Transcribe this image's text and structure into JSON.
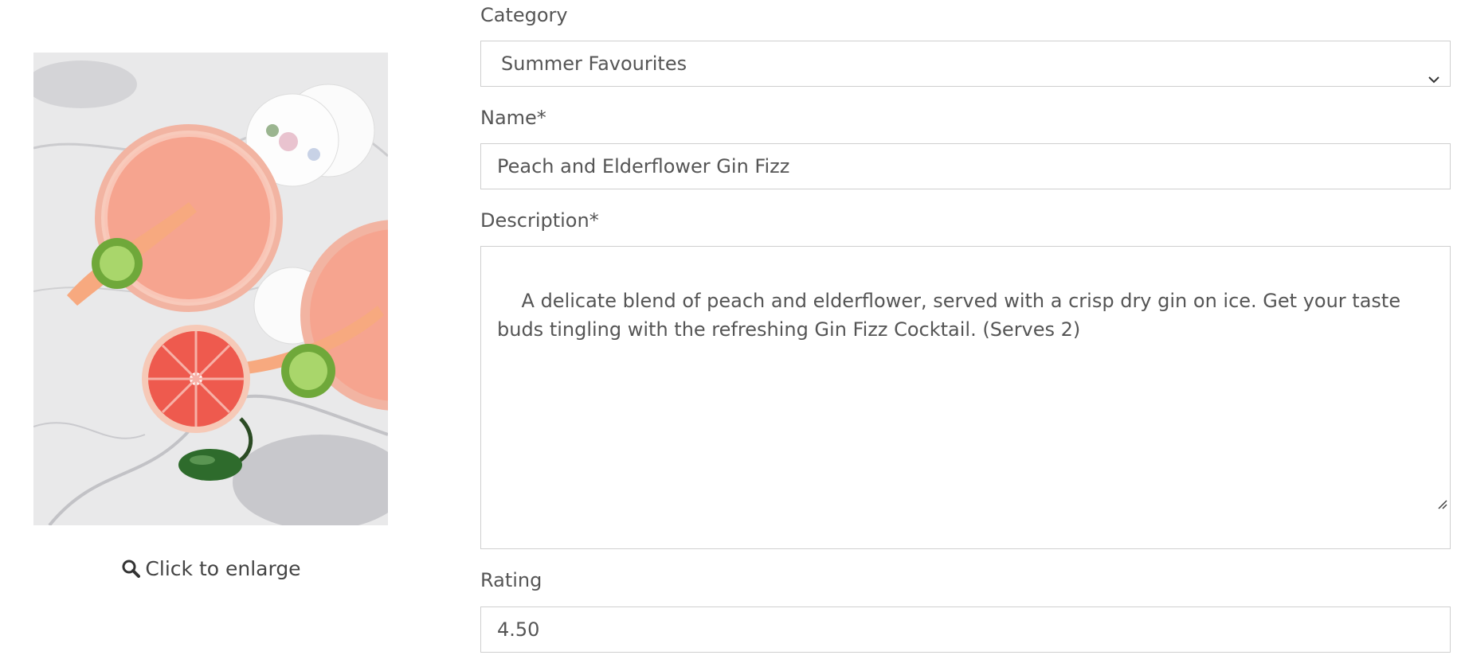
{
  "image_panel": {
    "photo_alt": "Peach and Elderflower Gin Fizz",
    "enlarge_label": "Click to enlarge",
    "enlarge_icon": "search-icon"
  },
  "form": {
    "category": {
      "label": "Category",
      "selected": "Summer Favourites"
    },
    "name": {
      "label": "Name*",
      "value": "Peach and Elderflower Gin Fizz"
    },
    "description": {
      "label": "Description*",
      "value": "A delicate blend of peach and elderflower, served with a crisp dry gin on ice. Get your taste buds tingling with the refreshing Gin Fizz Cocktail. (Serves 2)"
    },
    "rating": {
      "label": "Rating",
      "value": "4.50"
    }
  },
  "colors": {
    "text": "#555555",
    "border": "#cfcfcf",
    "drink": "#f4a08c",
    "grapefruit": "#ee5a4e",
    "pepper": "#2e6b2c"
  }
}
